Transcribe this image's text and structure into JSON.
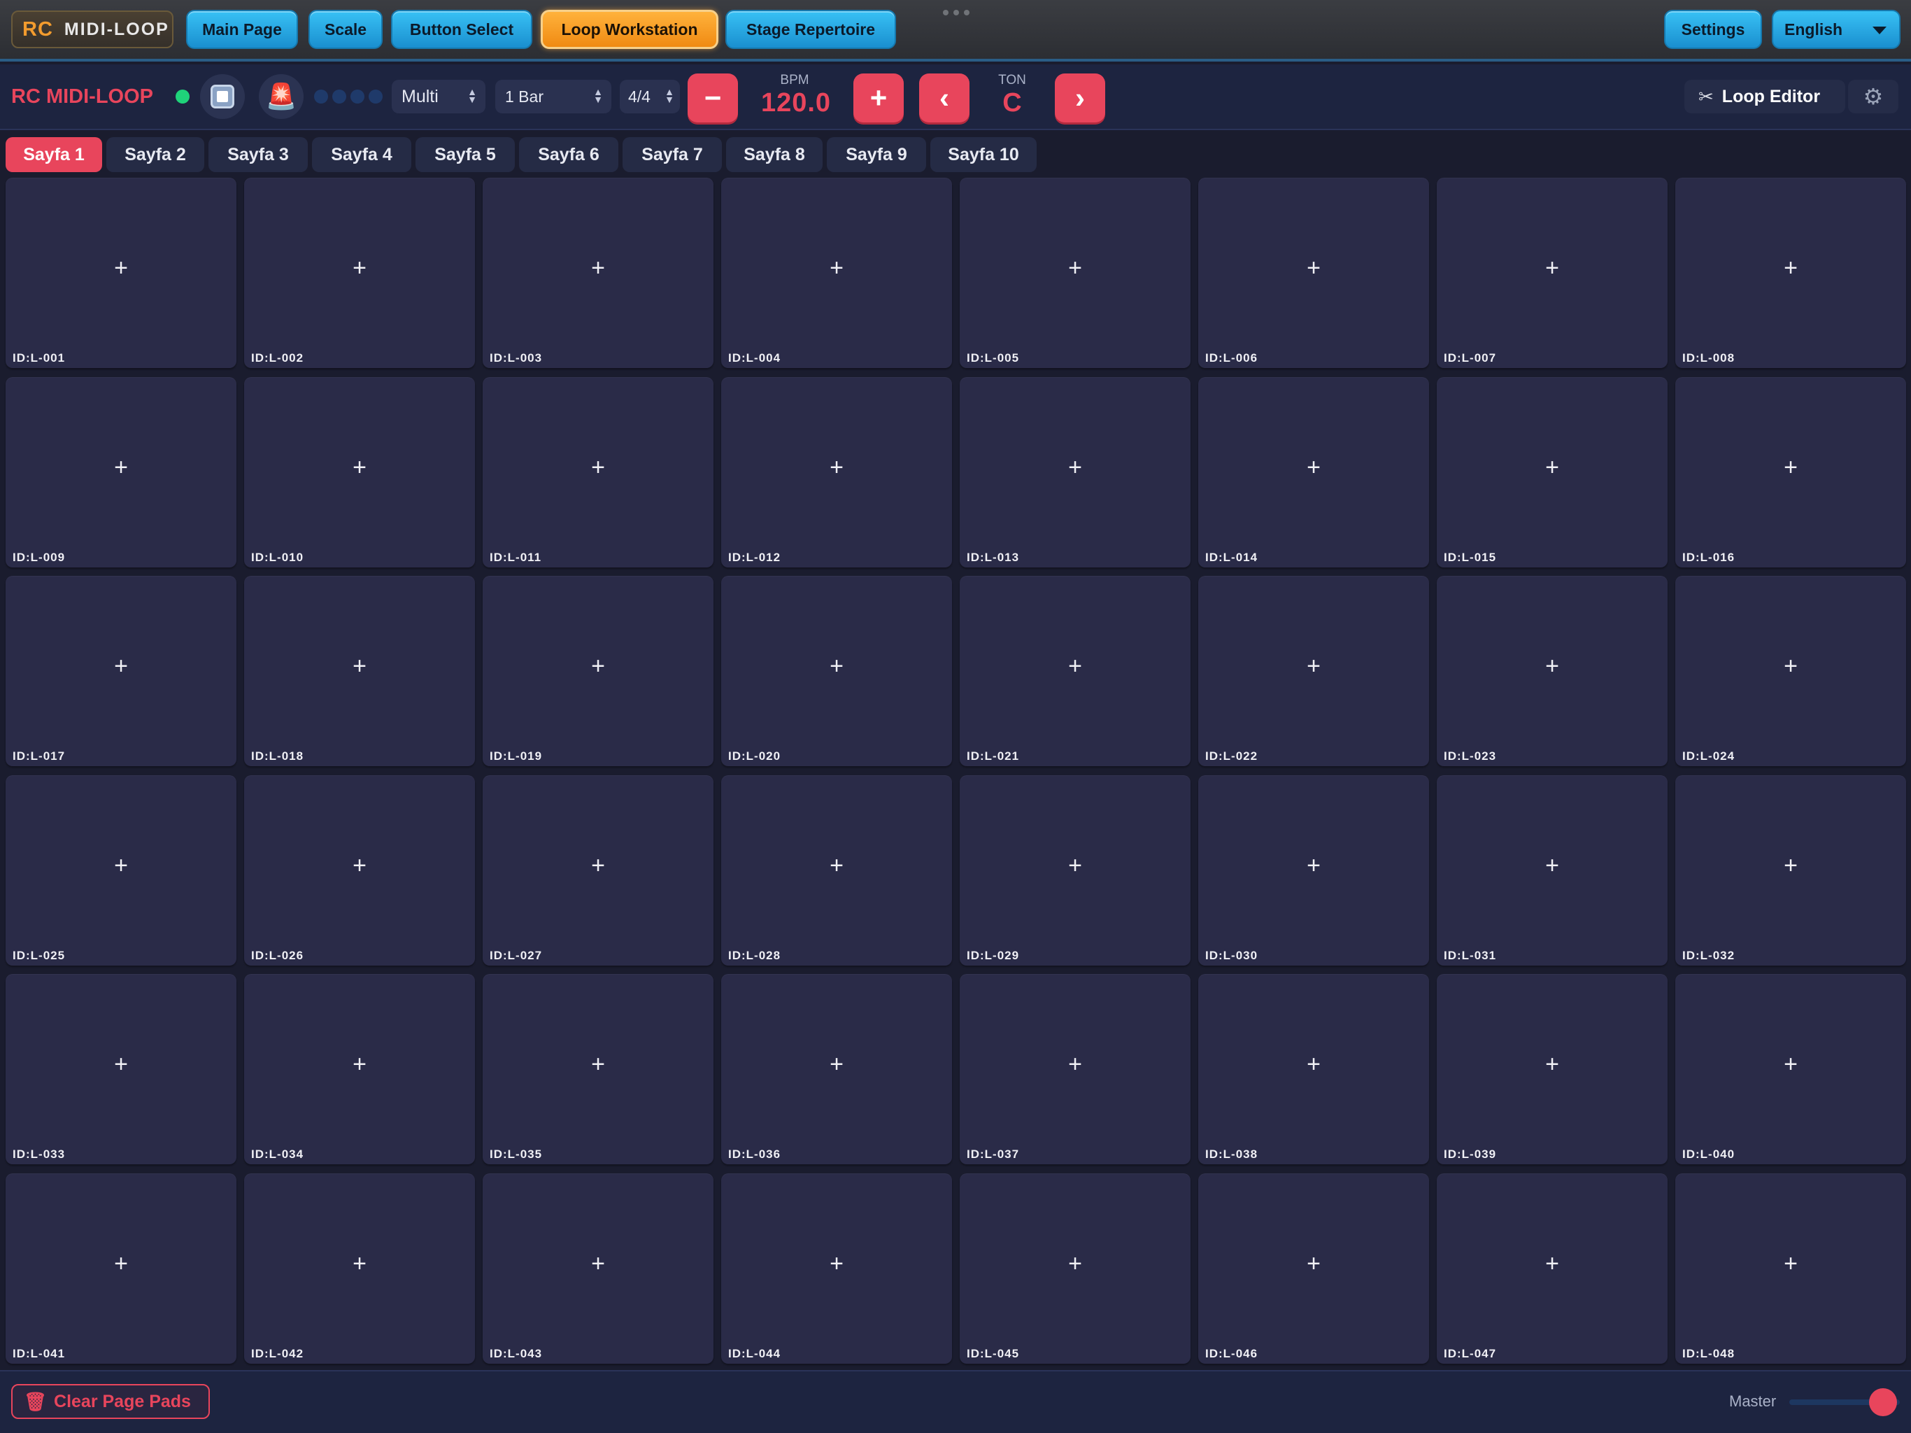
{
  "topnav": {
    "logo_rc": "RC",
    "logo_text": "MIDI-LOOP",
    "buttons": [
      {
        "label": "Main Page",
        "active": false
      },
      {
        "label": "Scale",
        "active": false
      },
      {
        "label": "Button Select",
        "active": false
      },
      {
        "label": "Loop Workstation",
        "active": true
      },
      {
        "label": "Stage Repertoire",
        "active": false
      }
    ],
    "settings_label": "Settings",
    "language_label": "English"
  },
  "toolbar": {
    "brand": "RC MIDI-LOOP",
    "mode_select": "Multi",
    "length_select": "1 Bar",
    "time_signature": "4/4",
    "bpm_label": "BPM",
    "bpm_value": "120.0",
    "minus_label": "−",
    "plus_label": "+",
    "prev_label": "‹",
    "next_label": "›",
    "ton_label": "TON",
    "ton_value": "C",
    "loop_editor_label": "Loop Editor",
    "loop_editor_icon": "scissors-icon",
    "settings_icon": "gear-icon"
  },
  "tabs": [
    "Sayfa 1",
    "Sayfa 2",
    "Sayfa 3",
    "Sayfa 4",
    "Sayfa 5",
    "Sayfa 6",
    "Sayfa 7",
    "Sayfa 8",
    "Sayfa 9",
    "Sayfa 10"
  ],
  "active_tab": 0,
  "pads": {
    "add_symbol": "+",
    "ids": [
      "ID:L-001",
      "ID:L-002",
      "ID:L-003",
      "ID:L-004",
      "ID:L-005",
      "ID:L-006",
      "ID:L-007",
      "ID:L-008",
      "ID:L-009",
      "ID:L-010",
      "ID:L-011",
      "ID:L-012",
      "ID:L-013",
      "ID:L-014",
      "ID:L-015",
      "ID:L-016",
      "ID:L-017",
      "ID:L-018",
      "ID:L-019",
      "ID:L-020",
      "ID:L-021",
      "ID:L-022",
      "ID:L-023",
      "ID:L-024",
      "ID:L-025",
      "ID:L-026",
      "ID:L-027",
      "ID:L-028",
      "ID:L-029",
      "ID:L-030",
      "ID:L-031",
      "ID:L-032",
      "ID:L-033",
      "ID:L-034",
      "ID:L-035",
      "ID:L-036",
      "ID:L-037",
      "ID:L-038",
      "ID:L-039",
      "ID:L-040",
      "ID:L-041",
      "ID:L-042",
      "ID:L-043",
      "ID:L-044",
      "ID:L-045",
      "ID:L-046",
      "ID:L-047",
      "ID:L-048"
    ]
  },
  "footer": {
    "clear_label": "Clear Page Pads",
    "clear_icon": "trash-icon",
    "master_label": "Master",
    "master_level": 0.85
  },
  "colors": {
    "accent_red": "#e8455c",
    "nav_blue": "#1a8fcf",
    "nav_active_orange": "#f08a12",
    "live_green": "#1fd37a",
    "pad_bg": "#2a2b48",
    "app_bg": "#1a1c2e"
  }
}
